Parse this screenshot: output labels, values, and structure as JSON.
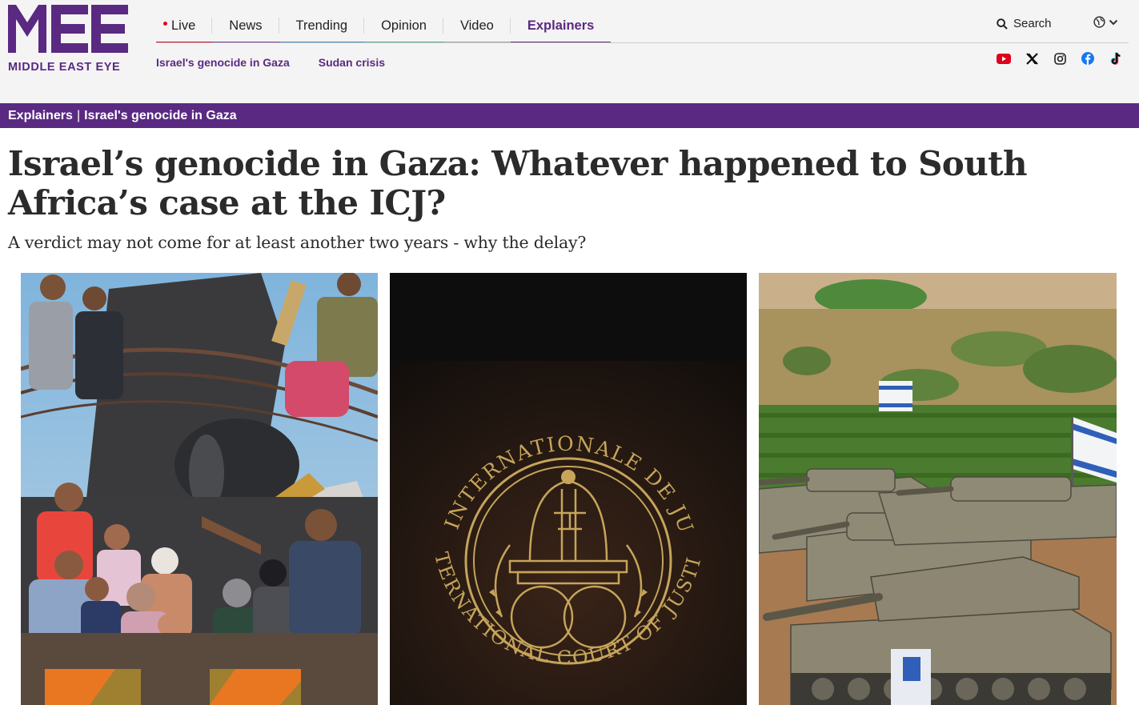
{
  "brand": {
    "logo_text": "MIDDLE EAST EYE",
    "accent": "#5a2a82",
    "live_color": "#e0001b"
  },
  "nav": {
    "items": [
      {
        "label": "Live",
        "color": "#e0001b"
      },
      {
        "label": "News",
        "color": "#7a3ea0"
      },
      {
        "label": "Trending",
        "color": "#3a8ac4"
      },
      {
        "label": "Opinion",
        "color": "#4ba89a"
      },
      {
        "label": "Video",
        "color": "#9aa3aa"
      },
      {
        "label": "Explainers",
        "color": "#5a2a82",
        "active": true
      }
    ],
    "sub_items": [
      "Israel's genocide in Gaza",
      "Sudan crisis"
    ],
    "search_label": "Search"
  },
  "socials": [
    "youtube-icon",
    "x-icon",
    "instagram-icon",
    "facebook-icon",
    "tiktok-icon"
  ],
  "breadcrumb": {
    "section": "Explainers",
    "separator": "|",
    "topic": "Israel's genocide in Gaza"
  },
  "article": {
    "headline": "Israel’s genocide in Gaza: Whatever happened to South Africa’s case at the ICJ?",
    "subheadline": "A verdict may not come for at least another two years - why the delay?"
  },
  "photos": {
    "seal_outer_text": "COUR INTERNATIONALE DE JUSTICE",
    "seal_inner_text": "INTERNATIONAL COURT OF JUSTICE"
  }
}
